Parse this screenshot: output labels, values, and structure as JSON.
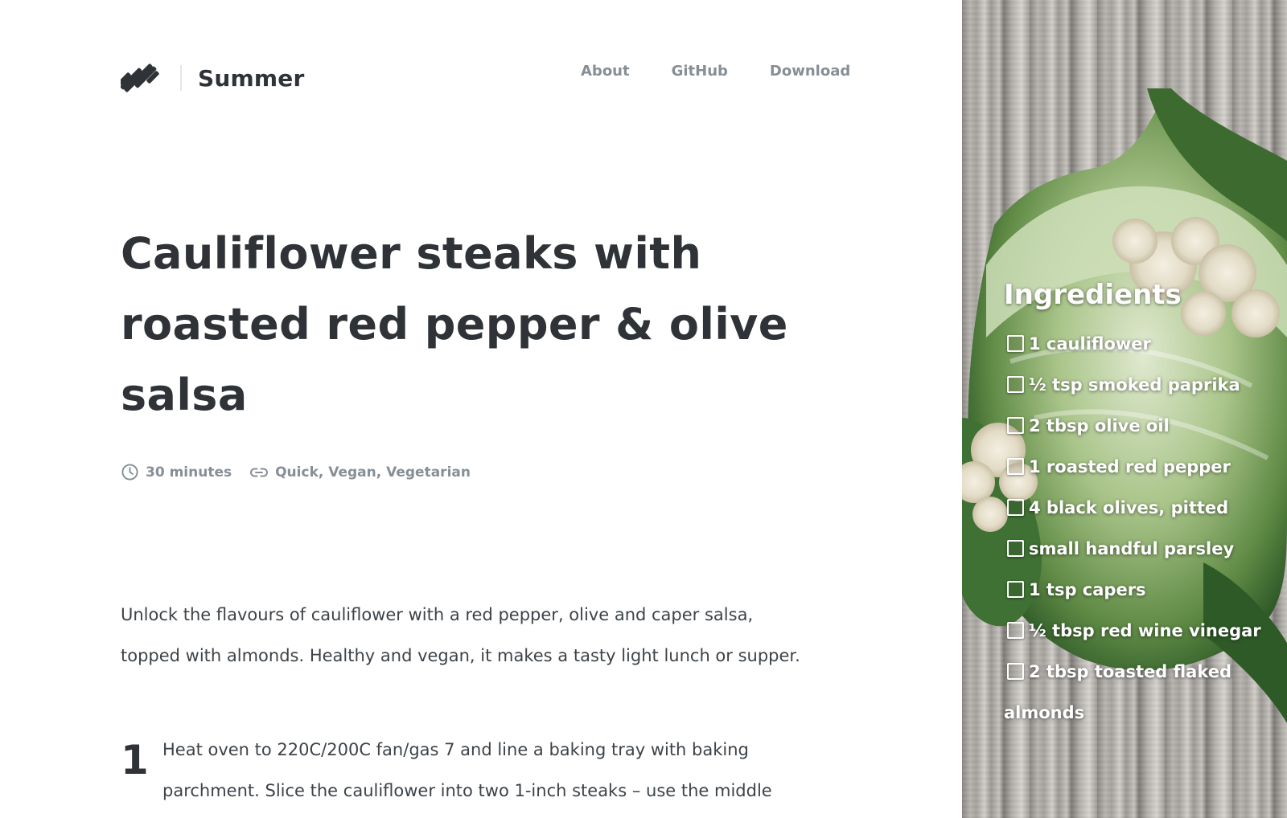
{
  "brand": {
    "name": "Summer",
    "logo_icon": "diagonal-stripes-logo-icon"
  },
  "nav": [
    {
      "label": "About"
    },
    {
      "label": "GitHub"
    },
    {
      "label": "Download"
    }
  ],
  "recipe": {
    "title": "Cauliflower steaks with roasted red pepper & olive salsa",
    "meta": {
      "time": "30 minutes",
      "time_icon": "clock-icon",
      "tags": "Quick, Vegan, Vegetarian",
      "tags_icon": "link-icon"
    },
    "intro": "Unlock the flavours of cauliflower with a red pepper, olive and caper salsa, topped with almonds. Healthy and vegan, it makes a tasty light lunch or supper.",
    "steps": [
      {
        "number": "1",
        "text": "Heat oven to 220C/200C fan/gas 7 and line a baking tray with baking parchment. Slice the cauliflower into two 1-inch steaks – use the middle"
      }
    ]
  },
  "ingredients": {
    "title": "Ingredients",
    "items": [
      {
        "label": "1 cauliflower",
        "checked": false
      },
      {
        "label": "½ tsp smoked paprika",
        "checked": false
      },
      {
        "label": "2 tbsp olive oil",
        "checked": false
      },
      {
        "label": "1 roasted red pepper",
        "checked": false
      },
      {
        "label": "4 black olives, pitted",
        "checked": false
      },
      {
        "label": "small handful parsley",
        "checked": false
      },
      {
        "label": "1 tsp capers",
        "checked": false
      },
      {
        "label": "½ tbsp red wine vinegar",
        "checked": false
      },
      {
        "label": "2 tbsp toasted flaked almonds",
        "checked": false
      }
    ]
  },
  "colors": {
    "text": "#2f3337",
    "muted": "#868e96",
    "background": "#ffffff",
    "panel_text": "#ffffff"
  }
}
